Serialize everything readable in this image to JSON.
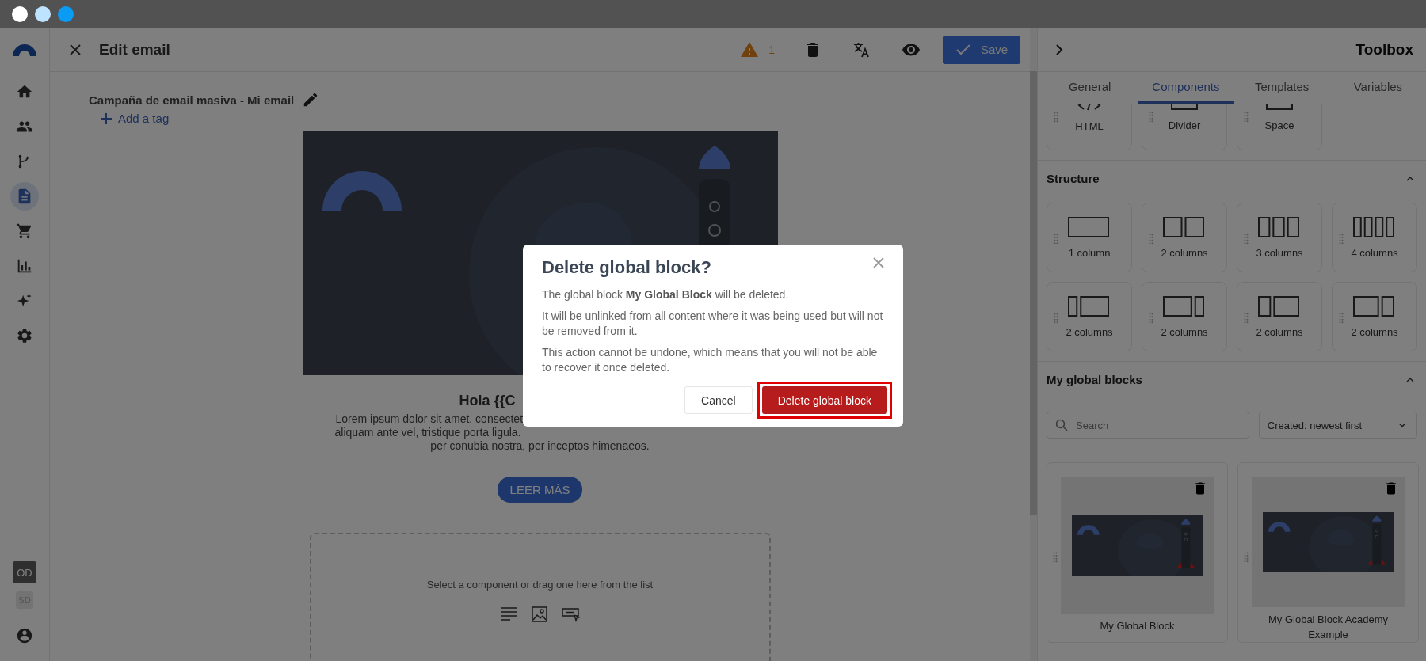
{
  "window": {
    "controls": [
      {
        "color": "#ffffff"
      },
      {
        "color": "#bde3ff"
      },
      {
        "color": "#0a9cf5"
      }
    ]
  },
  "rail": {
    "items": [
      {
        "kind": "home",
        "selected": false
      },
      {
        "kind": "people",
        "selected": false
      },
      {
        "kind": "flow",
        "selected": false
      },
      {
        "kind": "document",
        "selected": true
      },
      {
        "kind": "cart",
        "selected": false
      },
      {
        "kind": "chart",
        "selected": false
      },
      {
        "kind": "sparkle",
        "selected": false
      },
      {
        "kind": "settings",
        "selected": false
      }
    ],
    "badges": [
      {
        "label": "OD",
        "selected": true
      },
      {
        "label": "SD",
        "selected": false
      }
    ]
  },
  "header": {
    "title": "Edit email",
    "warning_count": "1",
    "save": "Save"
  },
  "email": {
    "name": "Campaña de email masiva - Mi email",
    "add_tag": "Add a tag",
    "heading": "Hola {{C",
    "body_lines": [
      "Lorem ipsum dolor sit amet, consectet",
      "aliquam ante vel, tristique porta ligula.",
      "per conubia nostra, per inceptos himenaeos."
    ],
    "button": "LEER MÁS",
    "dropzone_hint": "Select a component or drag one here from the list"
  },
  "toolbox": {
    "title": "Toolbox",
    "tabs": [
      {
        "label": "General",
        "selected": false
      },
      {
        "label": "Components",
        "selected": true
      },
      {
        "label": "Templates",
        "selected": false
      },
      {
        "label": "Variables",
        "selected": false
      }
    ],
    "basic_tiles": [
      {
        "label": "HTML",
        "kind": "code"
      },
      {
        "label": "Divider",
        "kind": "box"
      },
      {
        "label": "Space",
        "kind": "box"
      }
    ],
    "structure": {
      "title": "Structure",
      "expanded": true,
      "tiles": [
        {
          "label": "1 column",
          "kind": "single"
        },
        {
          "label": "2 columns",
          "kind": "halves"
        },
        {
          "label": "3 columns",
          "kind": "thirds"
        },
        {
          "label": "4 columns",
          "kind": "quarters"
        },
        {
          "label": "2 columns",
          "kind": "quarterleft"
        },
        {
          "label": "2 columns",
          "kind": "quarterright"
        },
        {
          "label": "2 columns",
          "kind": "thirdleft"
        },
        {
          "label": "2 columns",
          "kind": "thirdright"
        }
      ]
    },
    "global_blocks": {
      "title": "My global blocks",
      "expanded": true,
      "search_placeholder": "Search",
      "sort": "Created: newest first",
      "items": [
        {
          "name": "My Global Block"
        },
        {
          "name": "My Global Block Academy Example"
        }
      ]
    }
  },
  "dialog": {
    "title": "Delete global block?",
    "paragraphs": [
      "The global block **My Global Block** will be deleted.",
      "It will be unlinked from all content where it was being used but will not be removed from it.",
      "This action cannot be undone, which means that you will not be able to recover it once deleted."
    ],
    "cancel": "Cancel",
    "confirm": "Delete global block",
    "confirm_highlighted": true
  }
}
